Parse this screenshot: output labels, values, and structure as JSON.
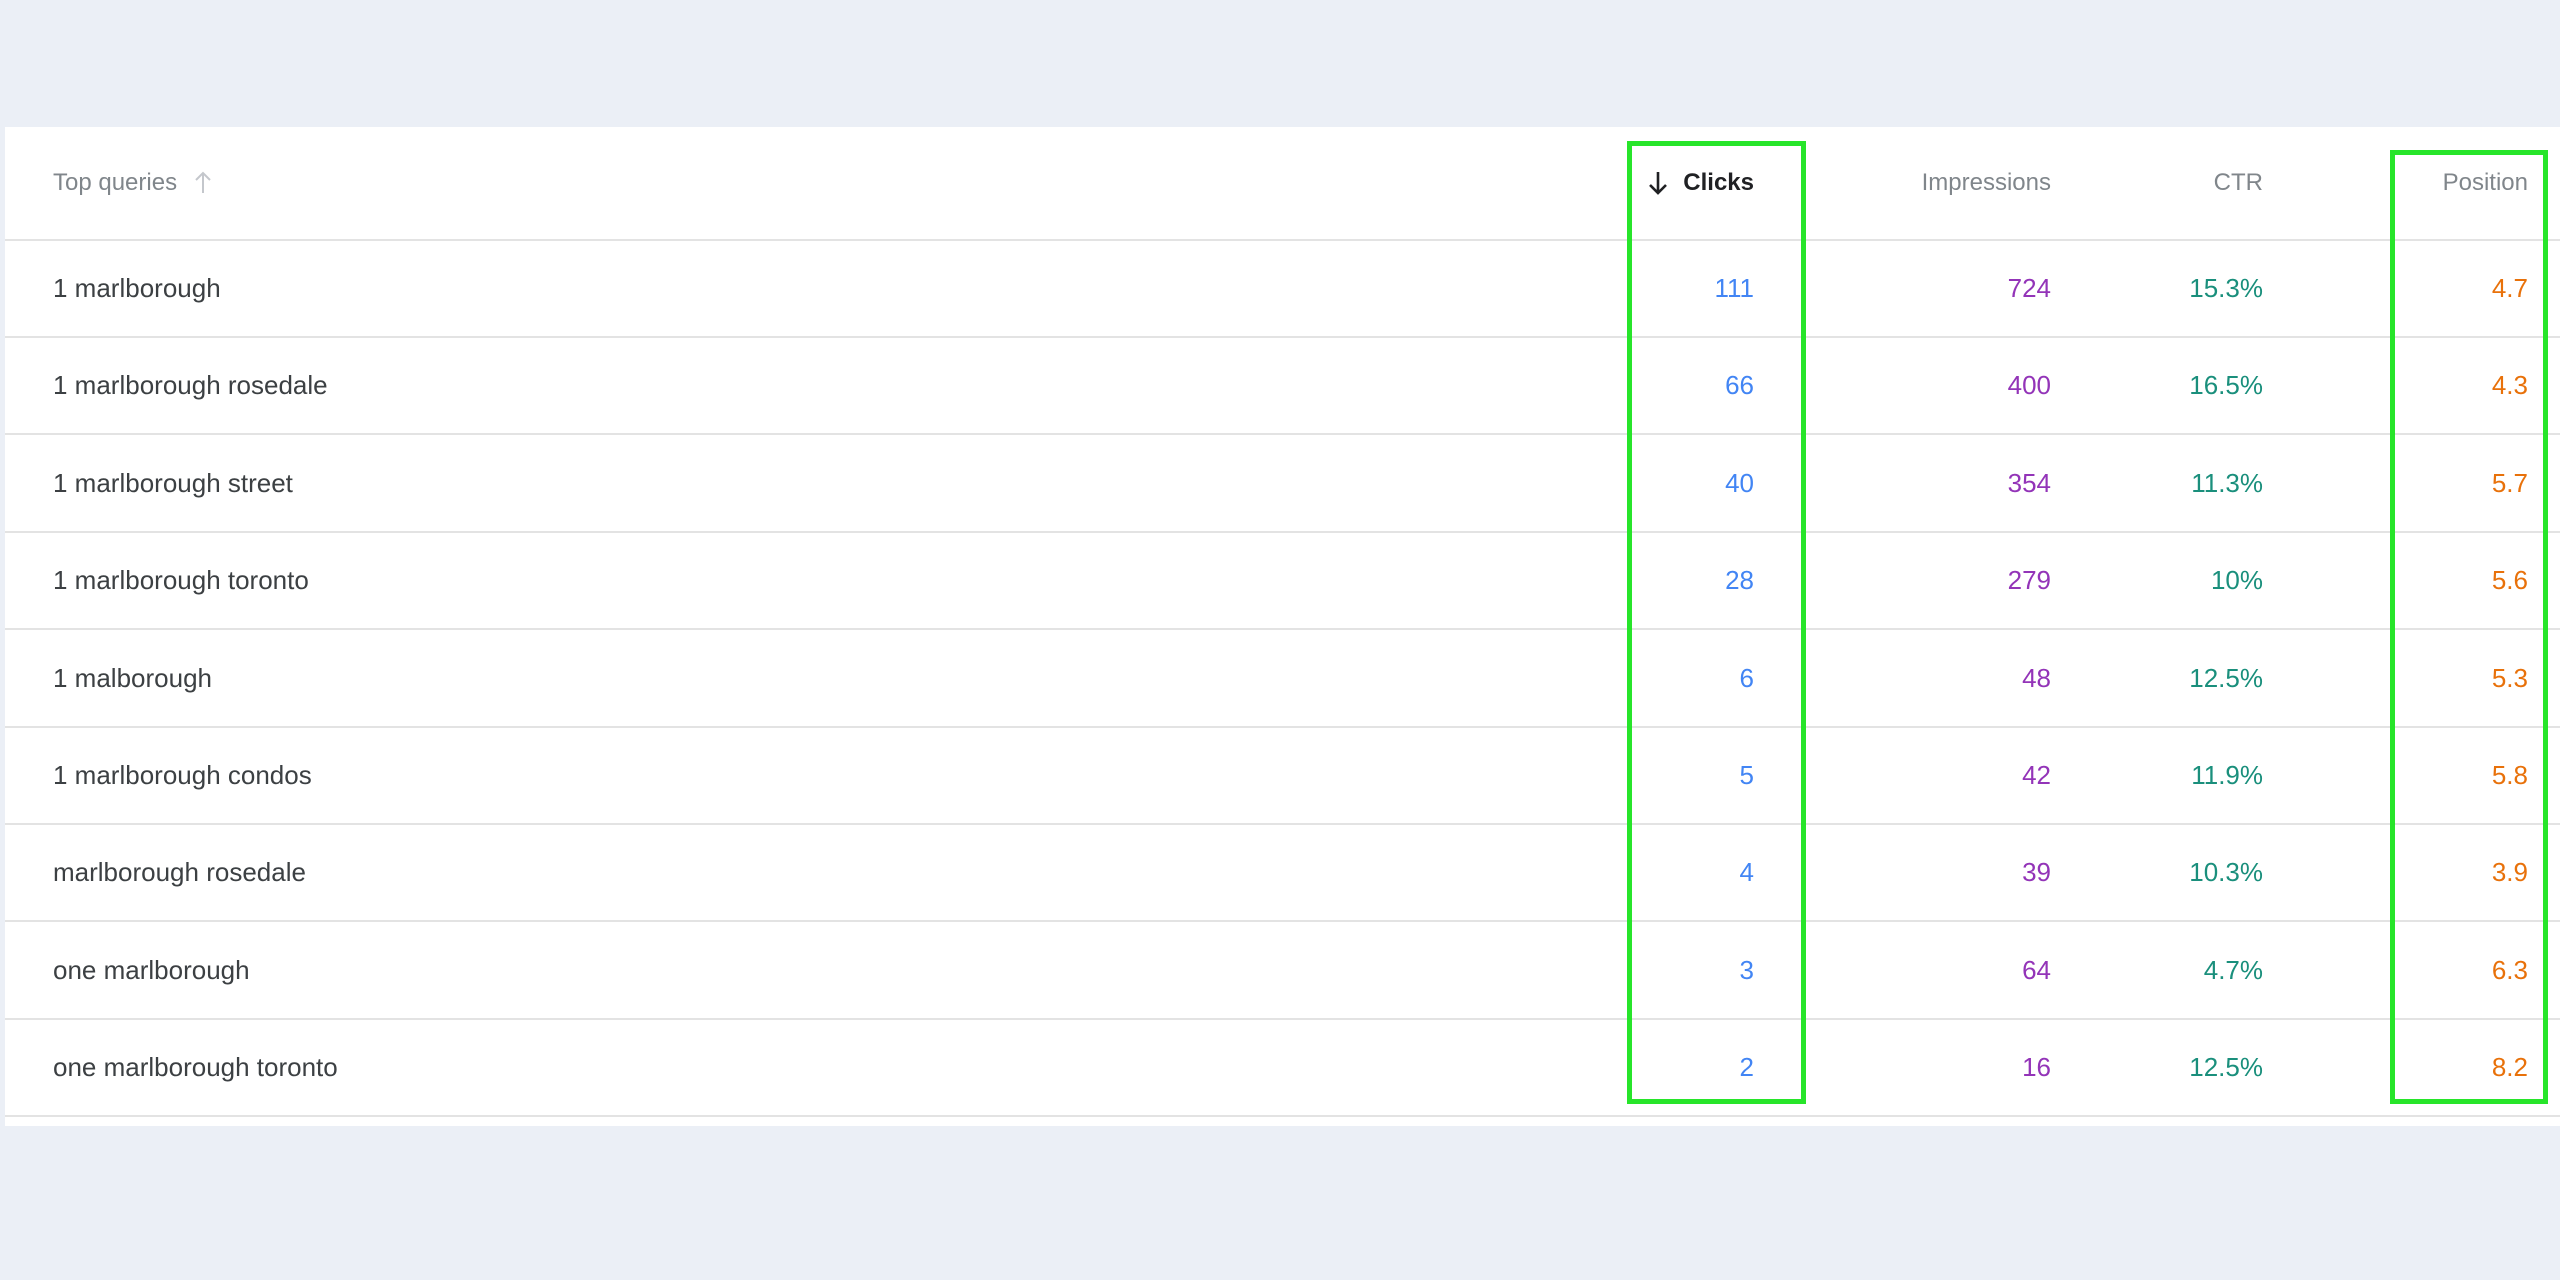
{
  "table": {
    "headers": {
      "query": "Top queries",
      "clicks": "Clicks",
      "impressions": "Impressions",
      "ctr": "CTR",
      "position": "Position"
    },
    "rows": [
      {
        "query": "1 marlborough",
        "clicks": "111",
        "impressions": "724",
        "ctr": "15.3%",
        "position": "4.7"
      },
      {
        "query": "1 marlborough rosedale",
        "clicks": "66",
        "impressions": "400",
        "ctr": "16.5%",
        "position": "4.3"
      },
      {
        "query": "1 marlborough street",
        "clicks": "40",
        "impressions": "354",
        "ctr": "11.3%",
        "position": "5.7"
      },
      {
        "query": "1 marlborough toronto",
        "clicks": "28",
        "impressions": "279",
        "ctr": "10%",
        "position": "5.6"
      },
      {
        "query": "1 malborough",
        "clicks": "6",
        "impressions": "48",
        "ctr": "12.5%",
        "position": "5.3"
      },
      {
        "query": "1 marlborough condos",
        "clicks": "5",
        "impressions": "42",
        "ctr": "11.9%",
        "position": "5.8"
      },
      {
        "query": "marlborough rosedale",
        "clicks": "4",
        "impressions": "39",
        "ctr": "10.3%",
        "position": "3.9"
      },
      {
        "query": "one marlborough",
        "clicks": "3",
        "impressions": "64",
        "ctr": "4.7%",
        "position": "6.3"
      },
      {
        "query": "one marlborough toronto",
        "clicks": "2",
        "impressions": "16",
        "ctr": "12.5%",
        "position": "8.2"
      }
    ]
  },
  "colors": {
    "clicks": "#4285f4",
    "impressions": "#9334b8",
    "ctr": "#1a8f7c",
    "position": "#e8710a",
    "highlight": "#27e52a"
  },
  "icons": {
    "sort_active": "arrow-down-icon",
    "sort_inactive": "arrow-up-icon"
  }
}
